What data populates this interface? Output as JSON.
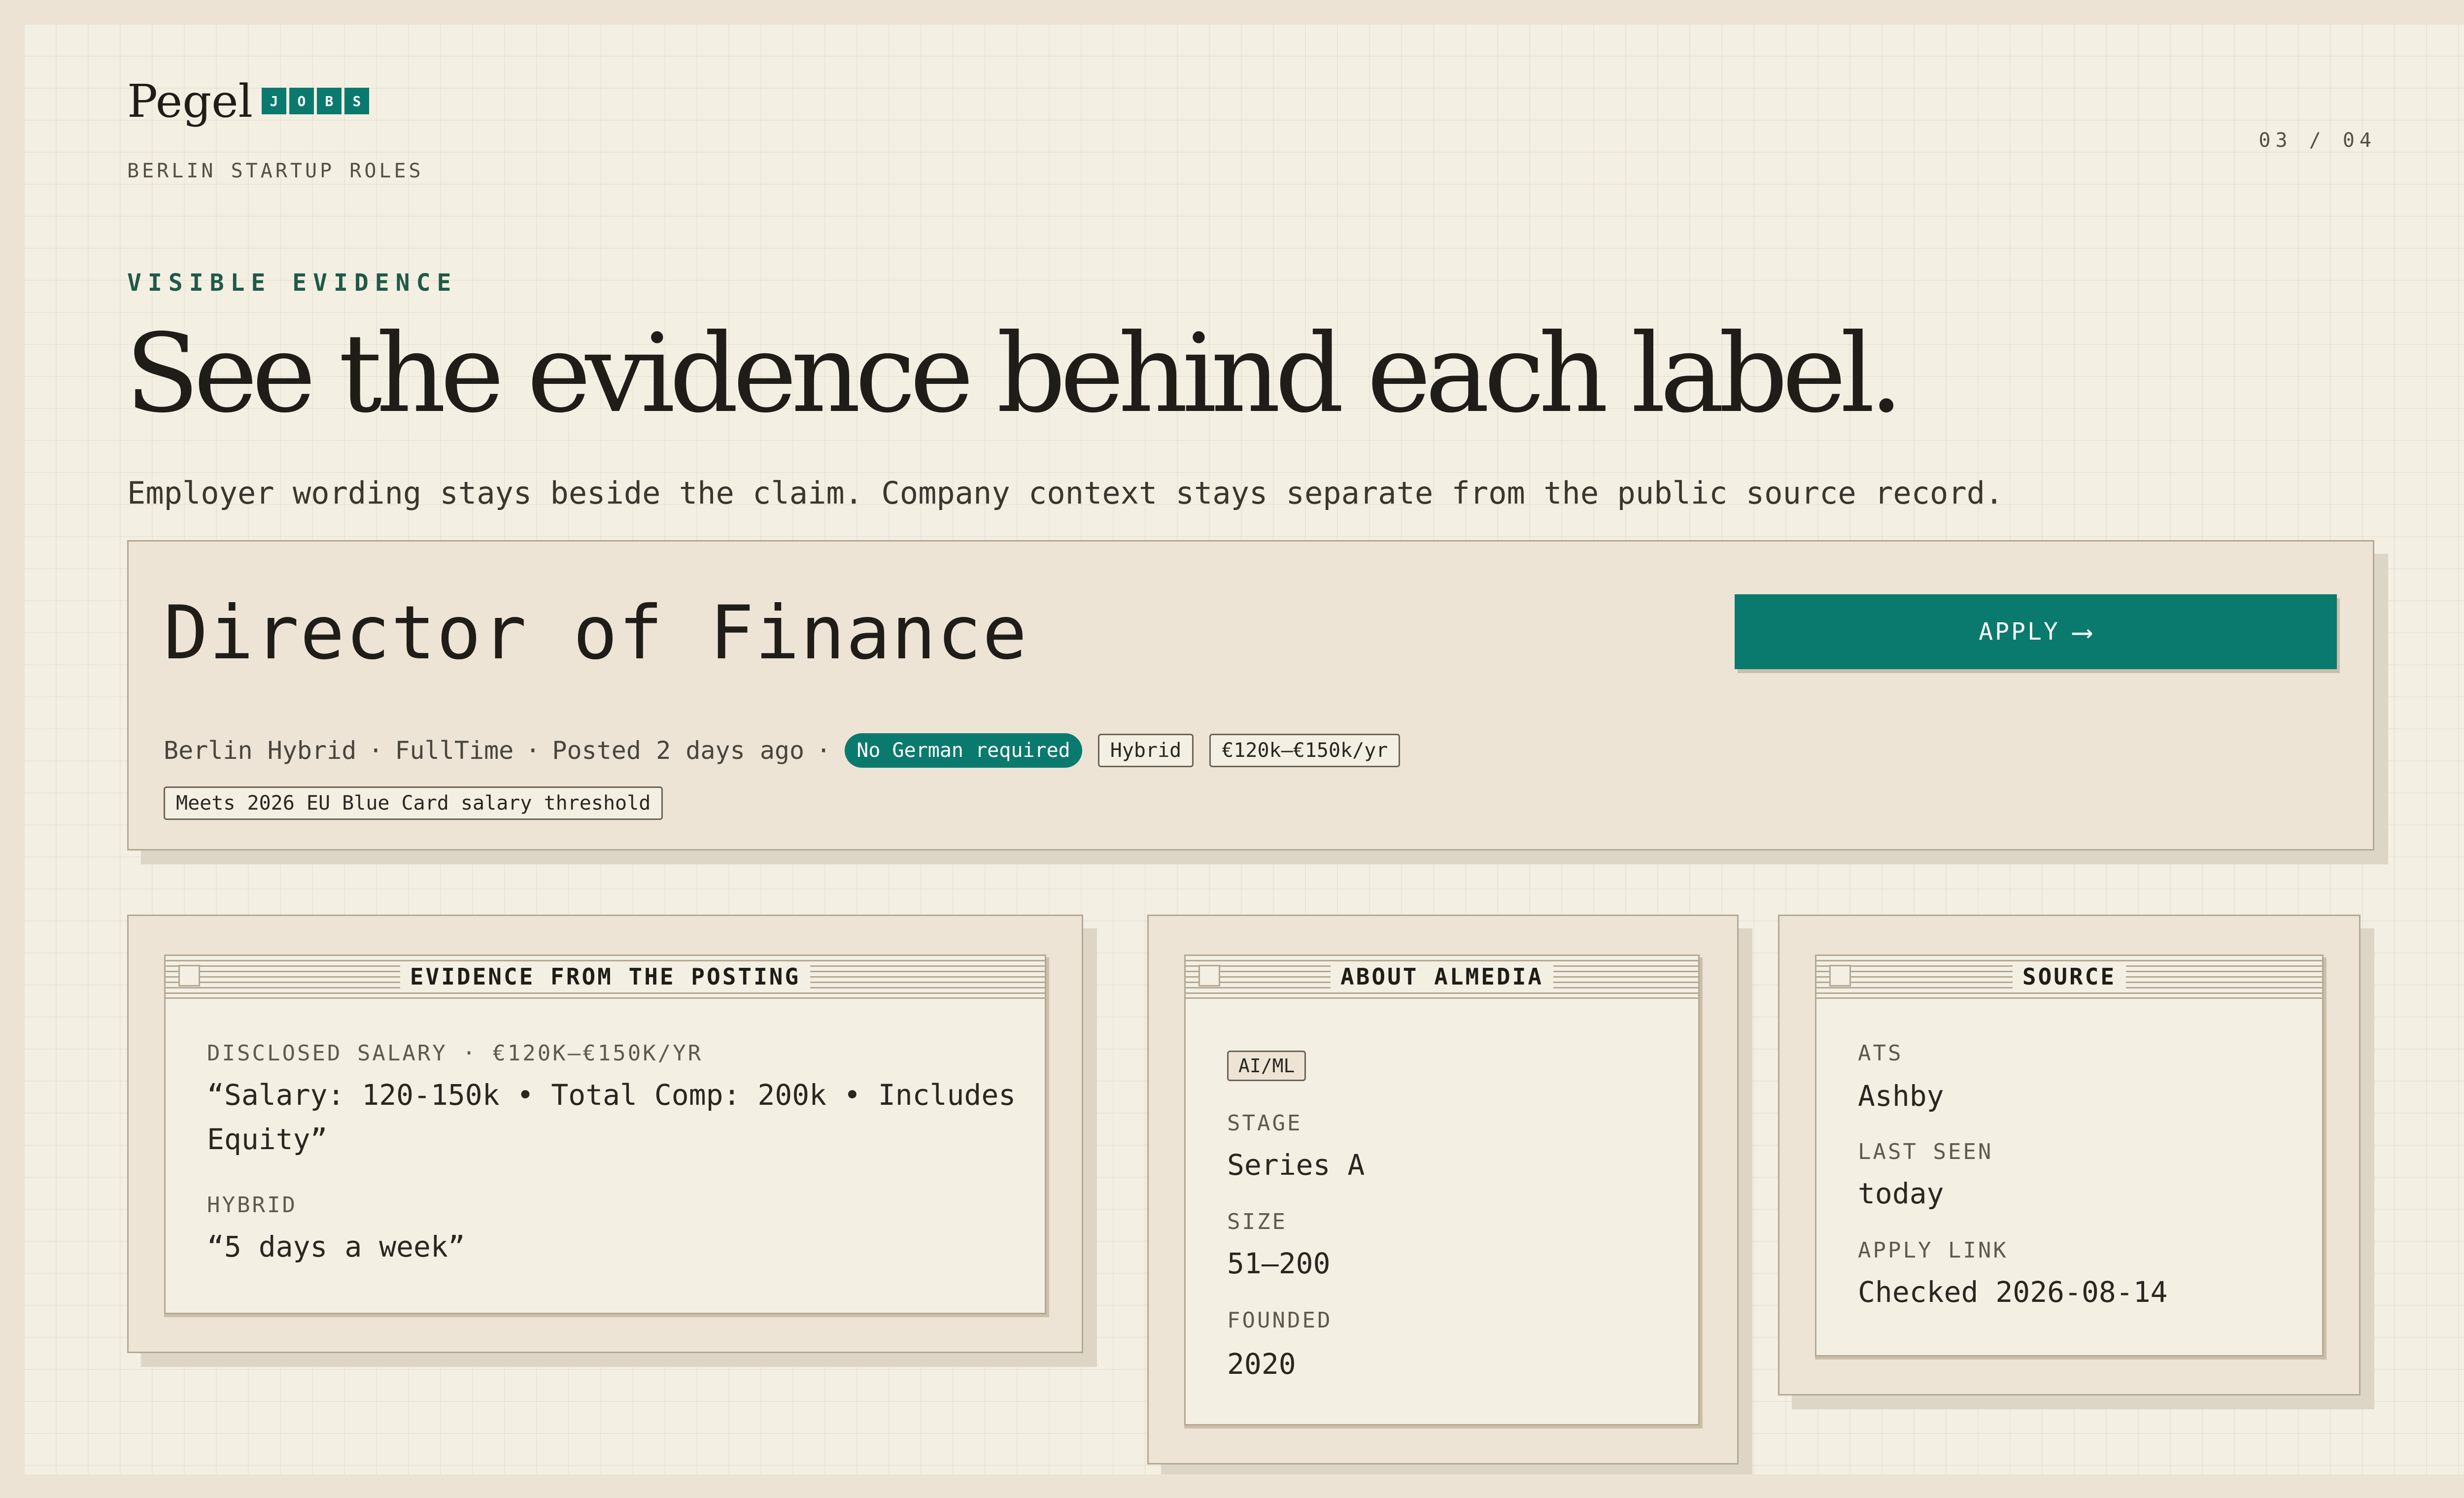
{
  "brand": {
    "name": "Pegel",
    "badge_letters": [
      "J",
      "O",
      "B",
      "S"
    ],
    "tagline": "BERLIN STARTUP ROLES"
  },
  "page_counter": "03 / 04",
  "section": {
    "eyebrow": "VISIBLE EVIDENCE",
    "headline": "See the evidence behind each label.",
    "subline": "Employer wording stays beside the claim. Company context stays separate from the public source record."
  },
  "job": {
    "title": "Director of Finance",
    "apply_label": "APPLY",
    "apply_arrow": "⟶",
    "location": "Berlin Hybrid",
    "employment": "FullTime",
    "posted": "Posted 2 days ago",
    "separator": "·",
    "badge_language": "No German required",
    "tag_mode": "Hybrid",
    "tag_salary": "€120k–€150k/yr",
    "tag_blue_card": "Meets 2026 EU Blue Card salary threshold"
  },
  "evidence_panel": {
    "title": "EVIDENCE FROM THE POSTING",
    "items": [
      {
        "label": "DISCLOSED SALARY · €120K–€150K/YR",
        "quote_line1": "“Salary: 120-150k • Total Comp: 200k • Includes",
        "quote_line2": "Equity”"
      },
      {
        "label": "HYBRID",
        "quote_line1": "“5 days a week”"
      }
    ]
  },
  "company_panel": {
    "title": "ABOUT ALMEDIA",
    "category_tag": "AI/ML",
    "fields": [
      {
        "label": "STAGE",
        "value": "Series A"
      },
      {
        "label": "SIZE",
        "value": "51–200"
      },
      {
        "label": "FOUNDED",
        "value": "2020"
      }
    ]
  },
  "source_panel": {
    "title": "SOURCE",
    "fields": [
      {
        "label": "ATS",
        "value": "Ashby"
      },
      {
        "label": "LAST SEEN",
        "value": "today"
      },
      {
        "label": "APPLY LINK",
        "value": "Checked 2026-08-14"
      }
    ]
  },
  "colors": {
    "accent": "#0b7a6e",
    "eyebrow": "#1e5a48",
    "page_bg": "#f4efe3",
    "card_bg": "#ede4d6",
    "border": "#b3a893"
  }
}
